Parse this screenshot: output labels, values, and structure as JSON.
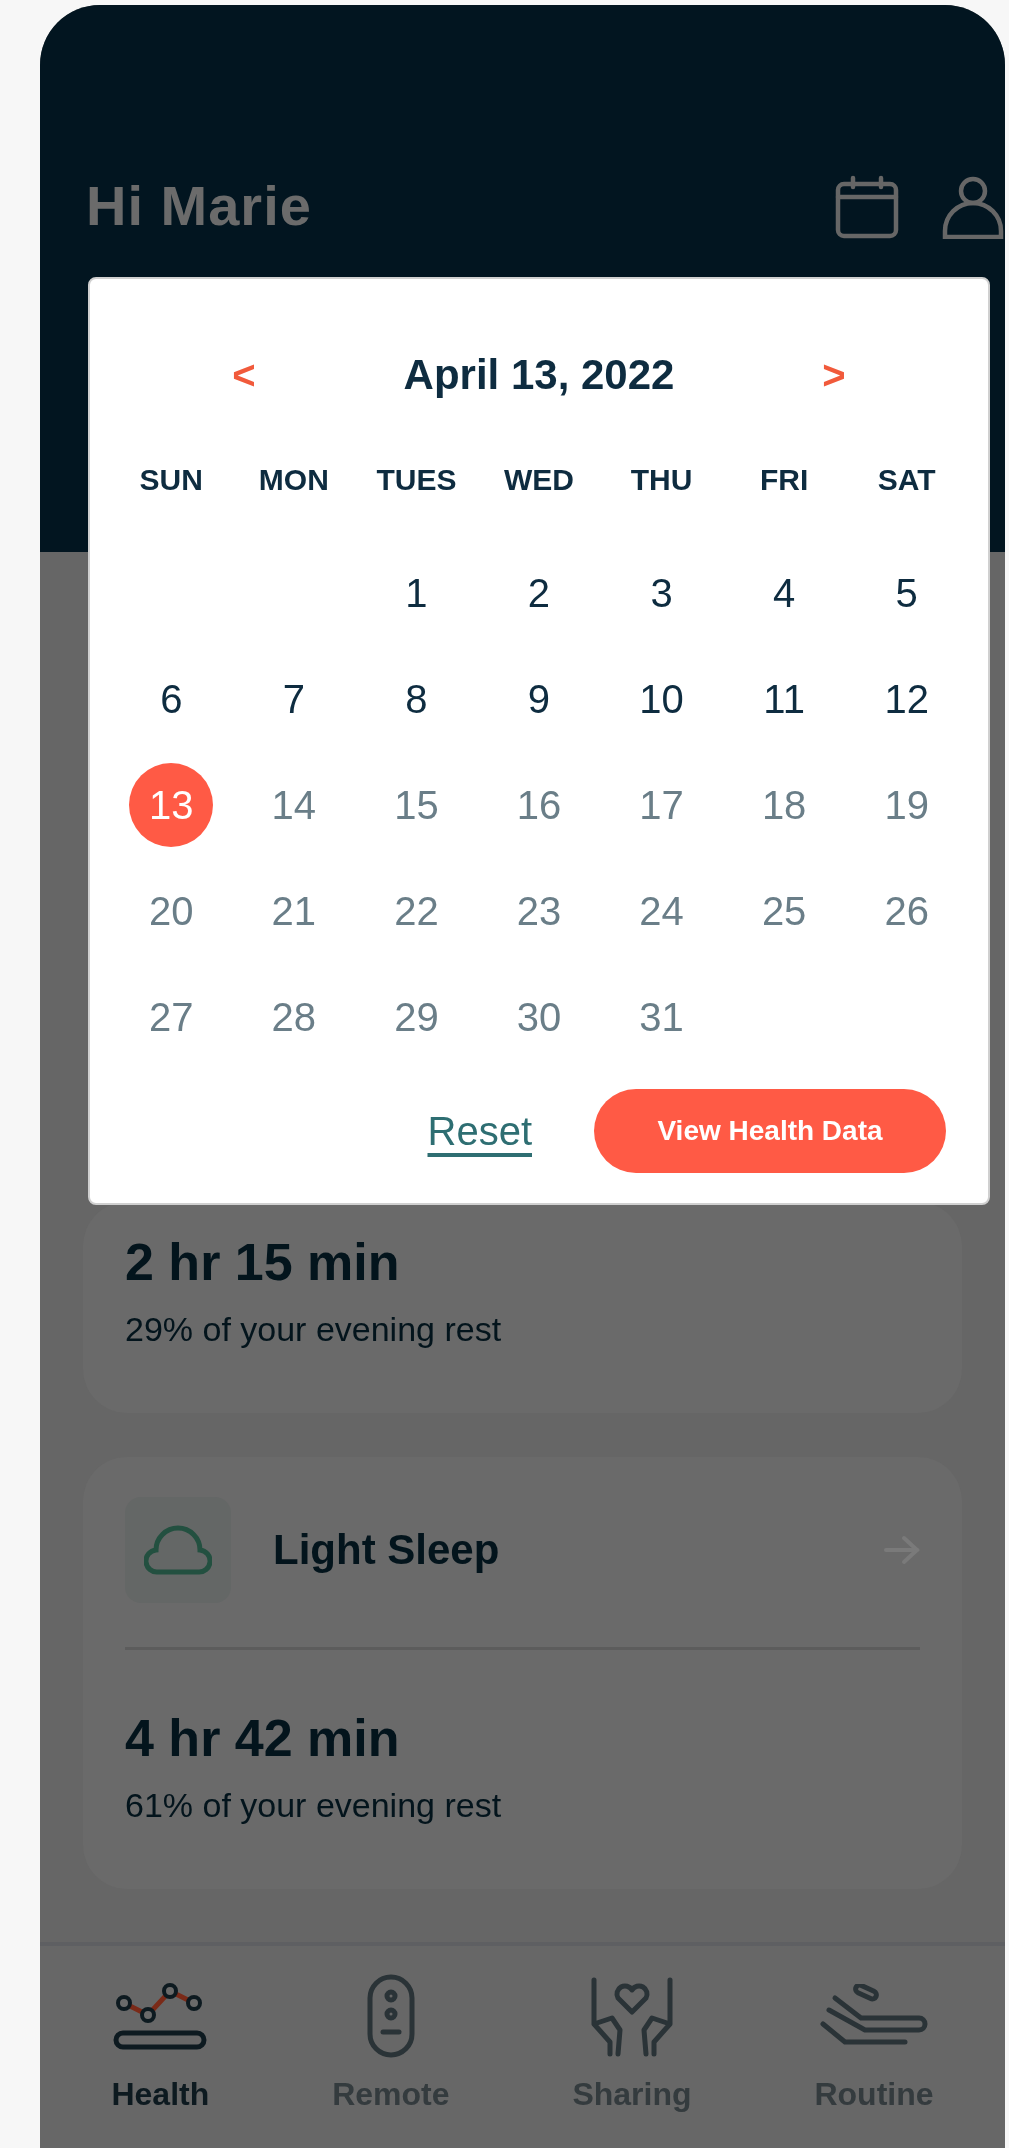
{
  "header": {
    "greeting": "Hi Marie"
  },
  "calendar": {
    "title": "April 13, 2022",
    "prev": "<",
    "next": ">",
    "weekdays": [
      "SUN",
      "MON",
      "TUES",
      "WED",
      "THU",
      "FRI",
      "SAT"
    ],
    "weeks": [
      [
        {
          "kind": "blank"
        },
        {
          "kind": "blank"
        },
        {
          "kind": "day",
          "label": "1",
          "selected": false,
          "disabled": false
        },
        {
          "kind": "day",
          "label": "2",
          "selected": false,
          "disabled": false
        },
        {
          "kind": "day",
          "label": "3",
          "selected": false,
          "disabled": false
        },
        {
          "kind": "day",
          "label": "4",
          "selected": false,
          "disabled": false
        },
        {
          "kind": "day",
          "label": "5",
          "selected": false,
          "disabled": false
        }
      ],
      [
        {
          "kind": "day",
          "label": "6",
          "selected": false,
          "disabled": false
        },
        {
          "kind": "day",
          "label": "7",
          "selected": false,
          "disabled": false
        },
        {
          "kind": "day",
          "label": "8",
          "selected": false,
          "disabled": false
        },
        {
          "kind": "day",
          "label": "9",
          "selected": false,
          "disabled": false
        },
        {
          "kind": "day",
          "label": "10",
          "selected": false,
          "disabled": false
        },
        {
          "kind": "day",
          "label": "11",
          "selected": false,
          "disabled": false
        },
        {
          "kind": "day",
          "label": "12",
          "selected": false,
          "disabled": false
        }
      ],
      [
        {
          "kind": "day",
          "label": "13",
          "selected": true,
          "disabled": false
        },
        {
          "kind": "day",
          "label": "14",
          "selected": false,
          "disabled": true
        },
        {
          "kind": "day",
          "label": "15",
          "selected": false,
          "disabled": true
        },
        {
          "kind": "day",
          "label": "16",
          "selected": false,
          "disabled": true
        },
        {
          "kind": "day",
          "label": "17",
          "selected": false,
          "disabled": true
        },
        {
          "kind": "day",
          "label": "18",
          "selected": false,
          "disabled": true
        },
        {
          "kind": "day",
          "label": "19",
          "selected": false,
          "disabled": true
        }
      ],
      [
        {
          "kind": "day",
          "label": "20",
          "selected": false,
          "disabled": true
        },
        {
          "kind": "day",
          "label": "21",
          "selected": false,
          "disabled": true
        },
        {
          "kind": "day",
          "label": "22",
          "selected": false,
          "disabled": true
        },
        {
          "kind": "day",
          "label": "23",
          "selected": false,
          "disabled": true
        },
        {
          "kind": "day",
          "label": "24",
          "selected": false,
          "disabled": true
        },
        {
          "kind": "day",
          "label": "25",
          "selected": false,
          "disabled": true
        },
        {
          "kind": "day",
          "label": "26",
          "selected": false,
          "disabled": true
        }
      ],
      [
        {
          "kind": "day",
          "label": "27",
          "selected": false,
          "disabled": true
        },
        {
          "kind": "day",
          "label": "28",
          "selected": false,
          "disabled": true
        },
        {
          "kind": "day",
          "label": "29",
          "selected": false,
          "disabled": true
        },
        {
          "kind": "day",
          "label": "30",
          "selected": false,
          "disabled": true
        },
        {
          "kind": "day",
          "label": "31",
          "selected": false,
          "disabled": true
        },
        {
          "kind": "blank"
        },
        {
          "kind": "blank"
        }
      ]
    ],
    "reset": "Reset",
    "action": "View Health Data"
  },
  "cards": [
    {
      "duration": "2 hr 15 min",
      "share": "29% of your evening rest"
    },
    {
      "title": "Light Sleep",
      "duration": "4 hr 42 min",
      "share": "61% of your evening rest"
    }
  ],
  "nav": [
    {
      "label": "Health",
      "kind": "health",
      "selected": true
    },
    {
      "label": "Remote",
      "kind": "remote",
      "selected": false
    },
    {
      "label": "Sharing",
      "kind": "sharing",
      "selected": false
    },
    {
      "label": "Routine",
      "kind": "routine",
      "selected": false
    }
  ]
}
